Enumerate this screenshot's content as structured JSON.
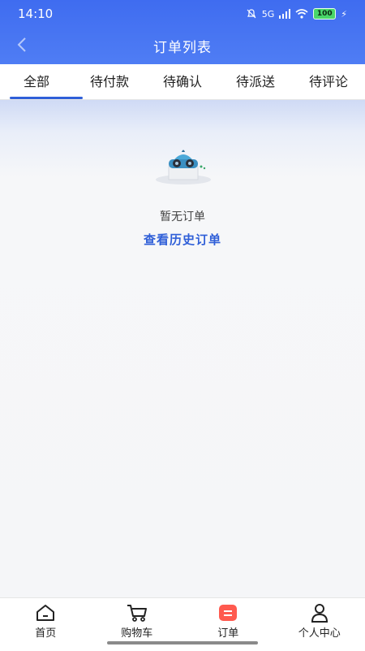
{
  "status_bar": {
    "time": "14:10",
    "signal": "5G",
    "battery": "100"
  },
  "header": {
    "title": "订单列表",
    "back_icon": "chevron-left-icon"
  },
  "tabs": [
    {
      "label": "全部",
      "active": true
    },
    {
      "label": "待付款",
      "active": false
    },
    {
      "label": "待确认",
      "active": false
    },
    {
      "label": "待派送",
      "active": false
    },
    {
      "label": "待评论",
      "active": false
    }
  ],
  "empty_state": {
    "message": "暂无订单",
    "link": "查看历史订单",
    "illustration": "mascot-illustration"
  },
  "bottom_nav": {
    "items": [
      {
        "label": "首页",
        "icon": "home-icon"
      },
      {
        "label": "购物车",
        "icon": "cart-icon"
      },
      {
        "label": "订单",
        "icon": "order-icon",
        "active": true
      },
      {
        "label": "个人中心",
        "icon": "user-icon"
      }
    ]
  },
  "colors": {
    "header": "#4f7df4",
    "accent": "#2f5fd8",
    "order_active": "#ff5a4f"
  }
}
